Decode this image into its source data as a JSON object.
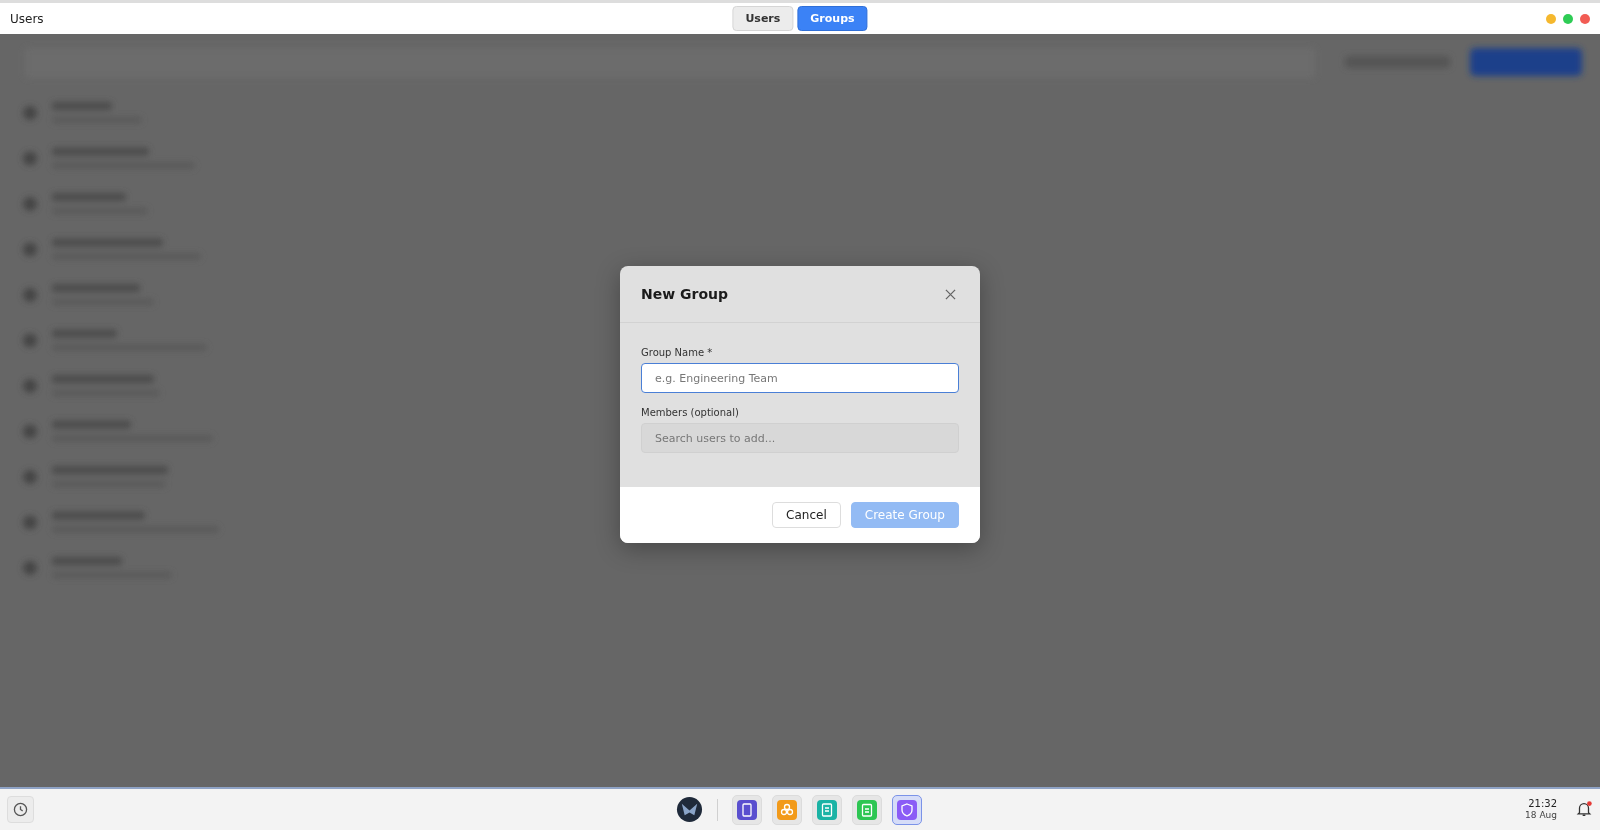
{
  "window": {
    "title": "Users",
    "tabs": [
      {
        "label": "Users",
        "selected": false
      },
      {
        "label": "Groups",
        "selected": true
      }
    ]
  },
  "dialog": {
    "title": "New Group",
    "fields": [
      {
        "label": "Group Name *",
        "placeholder": "e.g. Engineering Team",
        "focused": true
      },
      {
        "label": "Members (optional)",
        "placeholder": "Search users to add...",
        "focused": false
      }
    ],
    "buttons": [
      {
        "label": "Cancel",
        "kind": "secondary",
        "disabled": false
      },
      {
        "label": "Create Group",
        "kind": "primary",
        "disabled": true
      }
    ]
  },
  "taskbar": {
    "apps": [
      {
        "color": "#5a4fcf",
        "selected": false
      },
      {
        "color": "#f29a1a",
        "selected": false
      },
      {
        "color": "#1bb3a5",
        "selected": false
      },
      {
        "color": "#2dc653",
        "selected": false
      },
      {
        "color": "#8b5cf6",
        "selected": true
      }
    ],
    "time": "21:32",
    "date": "18 Aug",
    "notification": true
  }
}
